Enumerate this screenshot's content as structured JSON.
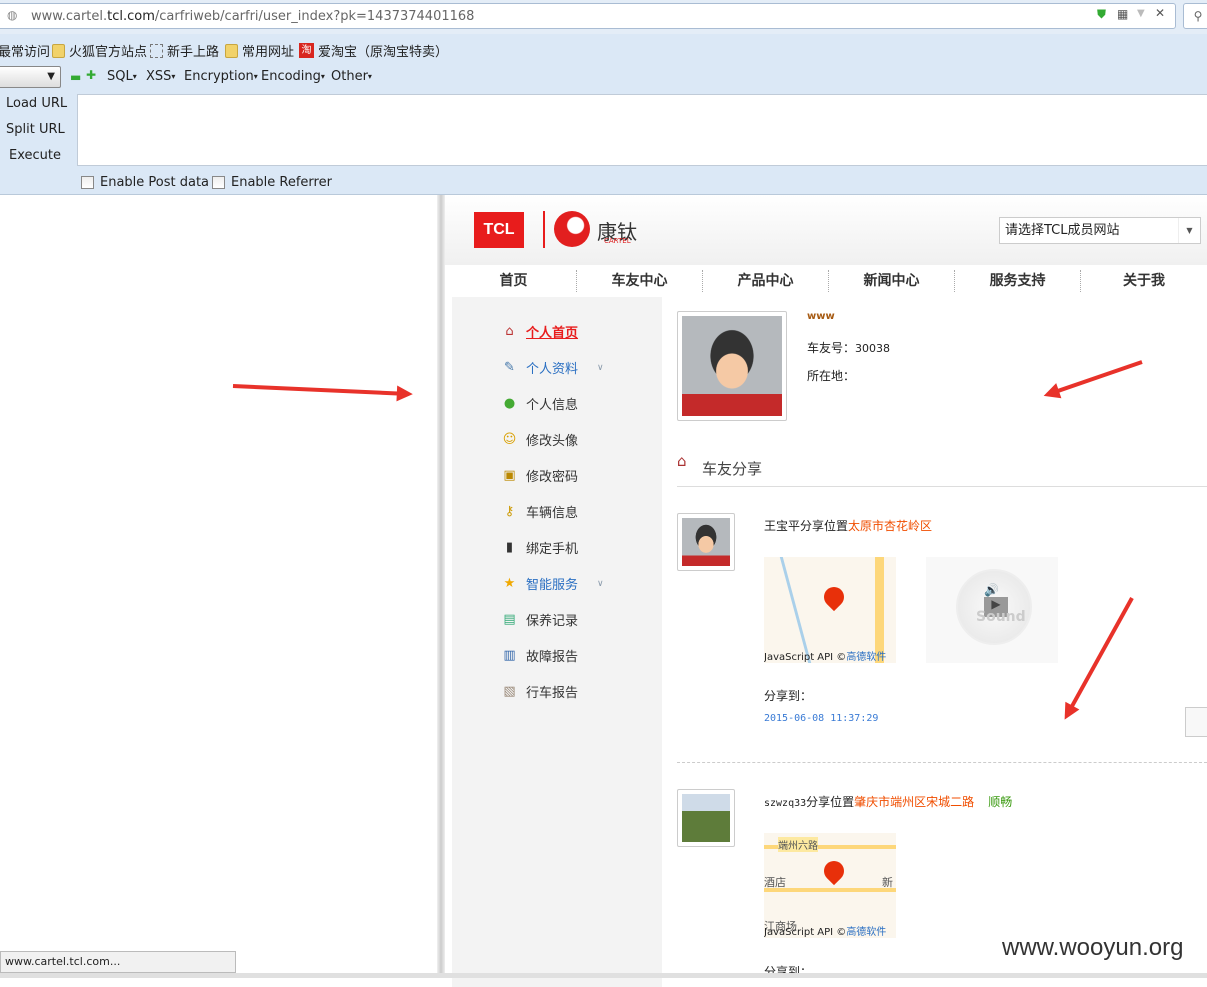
{
  "browser": {
    "url_host_pre": "www.cartel.",
    "url_host_bold": "tcl.com",
    "url_path": "/carfriweb/carfri/user_index?pk=1437374401168",
    "status_text": "www.cartel.tcl.com..."
  },
  "bookmarks": [
    "最常访问",
    "火狐官方站点",
    "新手上路",
    "常用网址",
    "爱淘宝（原淘宝特卖）"
  ],
  "taobao_glyph": "淘",
  "hackbar": {
    "menus": [
      "SQL",
      "XSS",
      "Encryption",
      "Encoding",
      "Other"
    ],
    "load_url": "Load URL",
    "split_url": "Split URL",
    "execute": "Execute",
    "enable_post": "Enable Post data",
    "enable_referrer": "Enable Referrer"
  },
  "site": {
    "logo_tcl": "TCL",
    "brand": "康钛",
    "brand_sub": "CARTEL",
    "member_select": "请选择TCL成员网站",
    "nav": [
      "首页",
      "车友中心",
      "产品中心",
      "新闻中心",
      "服务支持",
      "关于我"
    ],
    "sidebar": [
      {
        "label": "个人首页",
        "icon": "home-icon"
      },
      {
        "label": "个人资料",
        "icon": "edit-icon"
      },
      {
        "label": "个人信息",
        "icon": "user-icon"
      },
      {
        "label": "修改头像",
        "icon": "smile-icon"
      },
      {
        "label": "修改密码",
        "icon": "lock-icon"
      },
      {
        "label": "车辆信息",
        "icon": "key-icon"
      },
      {
        "label": "绑定手机",
        "icon": "phone-icon"
      },
      {
        "label": "智能服务",
        "icon": "star-icon"
      },
      {
        "label": "保养记录",
        "icon": "record-icon"
      },
      {
        "label": "故障报告",
        "icon": "report-icon"
      },
      {
        "label": "行车报告",
        "icon": "clipboard-icon"
      }
    ],
    "profile": {
      "name": "www",
      "id_label": "车友号：",
      "id_value": "30038",
      "location_label": "所在地："
    },
    "section_title": "车友分享",
    "shares": [
      {
        "user": "王宝平",
        "action": "分享位置",
        "place": "太原市杏花岭区",
        "status": "",
        "share_to": "分享到：",
        "time": "2015-06-08 11:37:29",
        "sound": "Sound"
      },
      {
        "user": "szwzq33",
        "action": "分享位置",
        "place": "肇庆市端州区宋城二路",
        "status": "顺畅",
        "share_to": "分享到：",
        "map_labels": [
          "端州六路",
          "酒店",
          "新",
          "江商场"
        ]
      }
    ],
    "map_credit": "JavaScript API ©",
    "map_credit_link": "高德软件"
  },
  "watermark": "www.wooyun.org"
}
